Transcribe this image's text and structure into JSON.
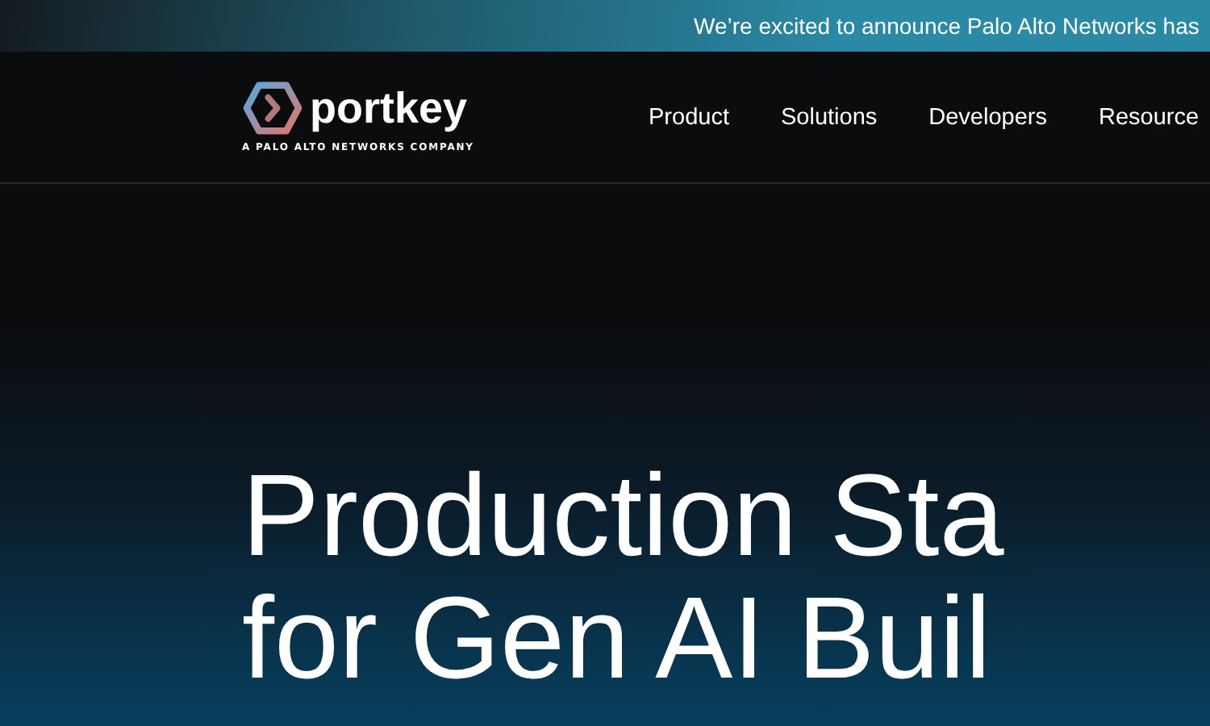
{
  "banner": {
    "text": "We’re excited to announce Palo Alto Networks has"
  },
  "logo": {
    "name": "portkey",
    "tagline": "A PALO ALTO NETWORKS COMPANY"
  },
  "nav": {
    "items": [
      "Product",
      "Solutions",
      "Developers",
      "Resource"
    ]
  },
  "hero": {
    "headline_lines": [
      "Production Sta",
      "for Gen AI Buil"
    ]
  }
}
